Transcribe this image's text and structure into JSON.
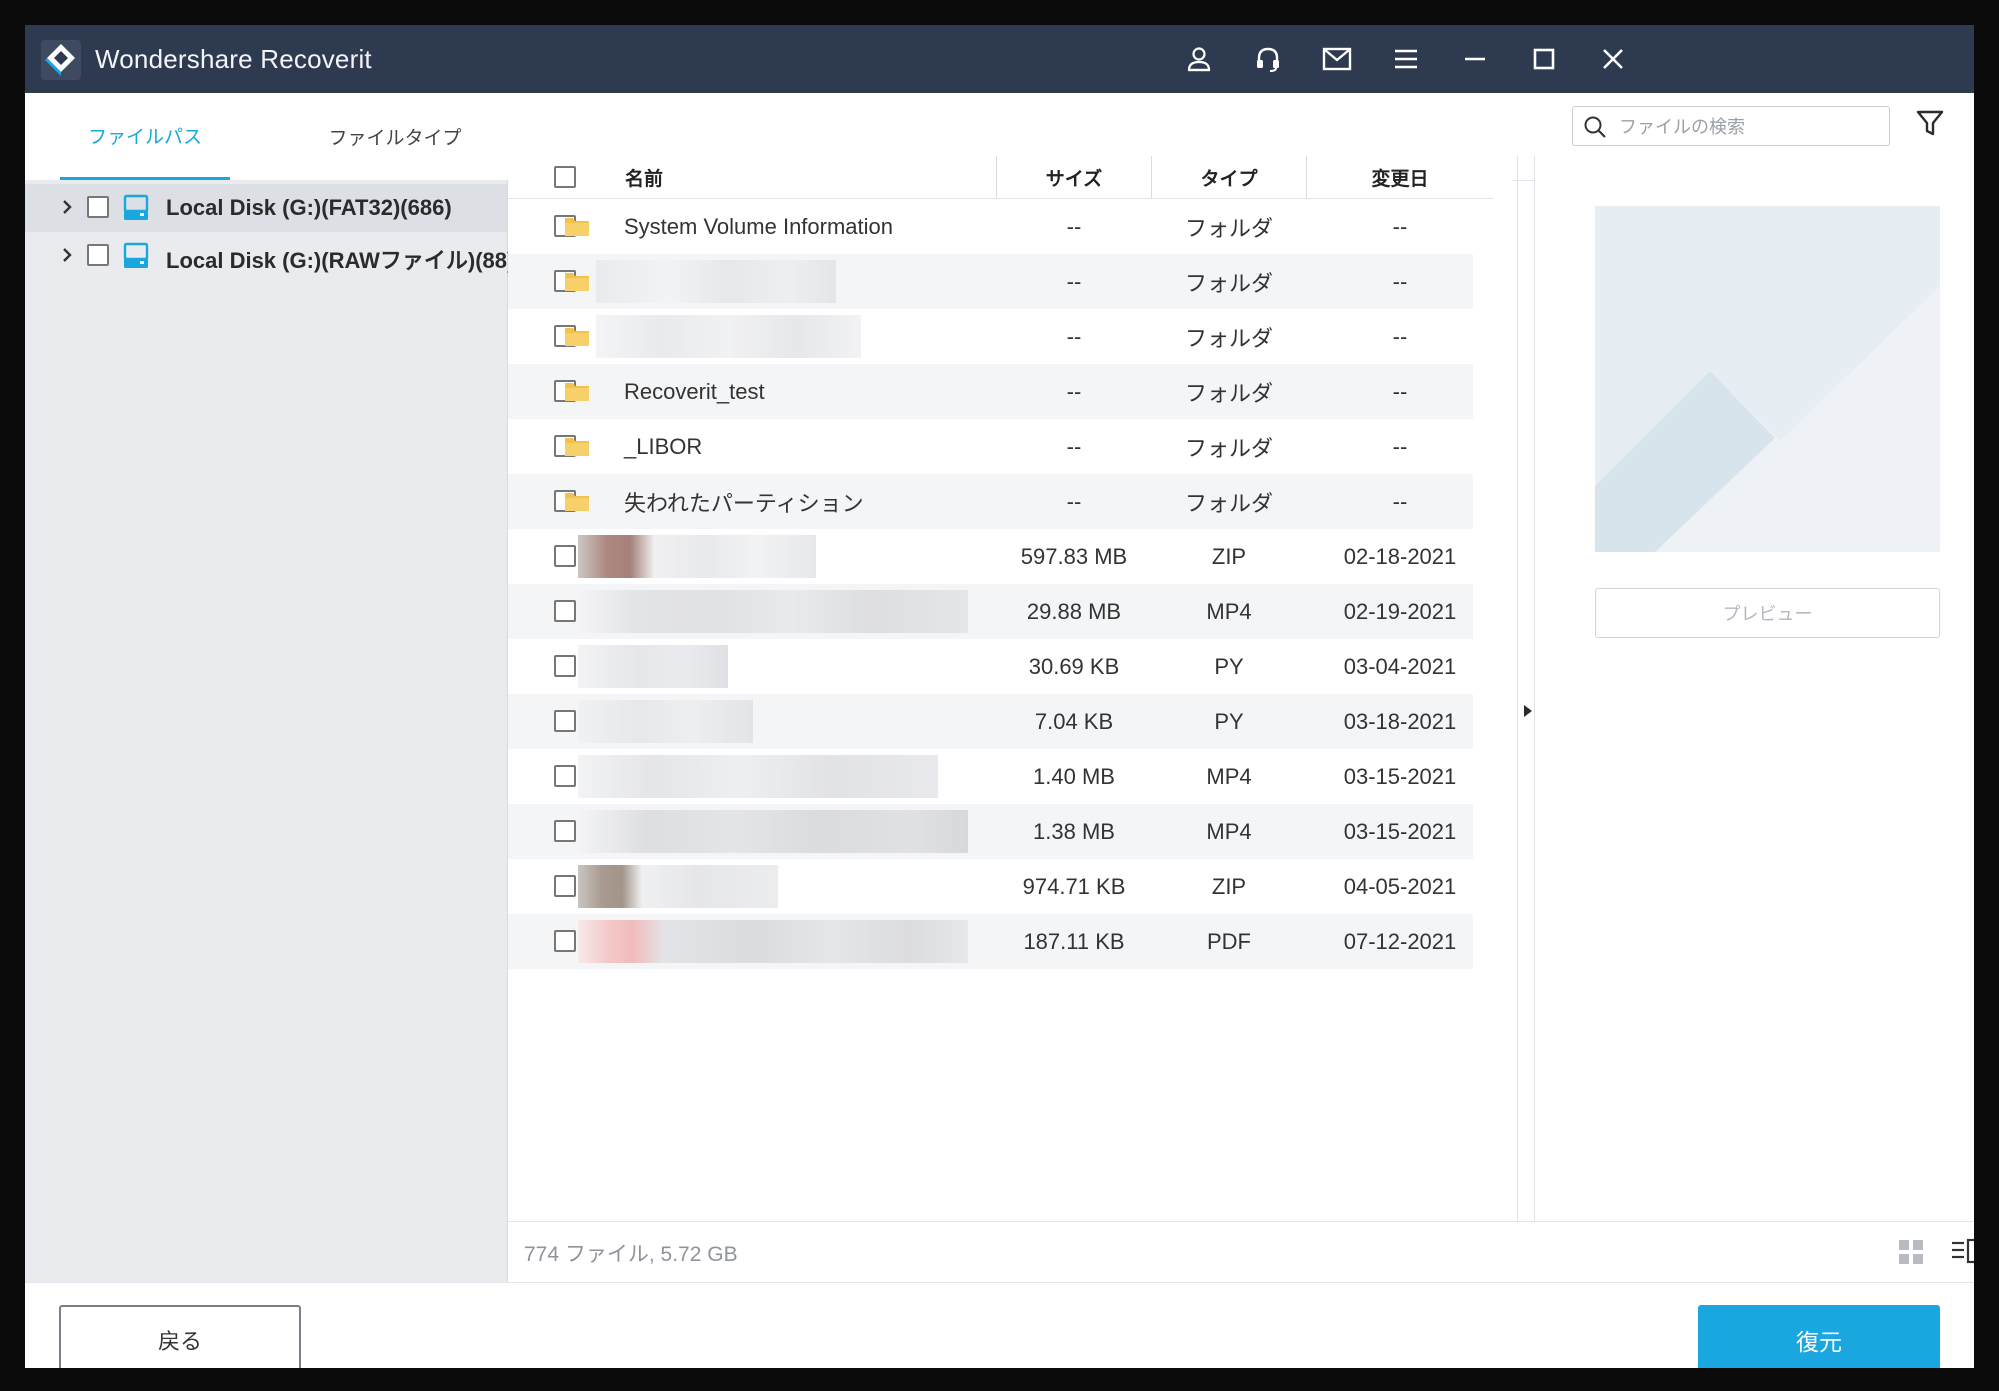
{
  "app": {
    "title": "Wondershare Recoverit"
  },
  "titlebar_icons": [
    "user-icon",
    "headset-icon",
    "mail-icon",
    "menu-icon",
    "minimize-icon",
    "maximize-icon",
    "close-icon"
  ],
  "tabs": {
    "file_path": "ファイルパス",
    "file_type": "ファイルタイプ"
  },
  "tree": [
    {
      "label": "Local Disk (G:)(FAT32)(686)",
      "selected": true
    },
    {
      "label": "Local Disk (G:)(RAWファイル)(88)",
      "selected": false
    }
  ],
  "search": {
    "placeholder": "ファイルの検索"
  },
  "table": {
    "headers": {
      "name": "名前",
      "size": "サイズ",
      "type": "タイプ",
      "modified": "変更日"
    },
    "rows": [
      {
        "name": "System Volume Information",
        "size": "--",
        "type": "フォルダ",
        "date": "--",
        "kind": "folder"
      },
      {
        "name": "",
        "size": "--",
        "type": "フォルダ",
        "date": "--",
        "kind": "folder"
      },
      {
        "name": "",
        "size": "--",
        "type": "フォルダ",
        "date": "--",
        "kind": "folder"
      },
      {
        "name": "Recoverit_test",
        "size": "--",
        "type": "フォルダ",
        "date": "--",
        "kind": "folder"
      },
      {
        "name": "_LIBOR",
        "size": "--",
        "type": "フォルダ",
        "date": "--",
        "kind": "folder"
      },
      {
        "name": "失われたパーティション",
        "size": "--",
        "type": "フォルダ",
        "date": "--",
        "kind": "folder"
      },
      {
        "name": "",
        "size": "597.83 MB",
        "type": "ZIP",
        "date": "02-18-2021",
        "kind": "file"
      },
      {
        "name": "",
        "size": "29.88 MB",
        "type": "MP4",
        "date": "02-19-2021",
        "kind": "file"
      },
      {
        "name": "",
        "size": "30.69 KB",
        "type": "PY",
        "date": "03-04-2021",
        "kind": "file"
      },
      {
        "name": "",
        "size": "7.04 KB",
        "type": "PY",
        "date": "03-18-2021",
        "kind": "file"
      },
      {
        "name": "",
        "size": "1.40 MB",
        "type": "MP4",
        "date": "03-15-2021",
        "kind": "file"
      },
      {
        "name": "",
        "size": "1.38 MB",
        "type": "MP4",
        "date": "03-15-2021",
        "kind": "file"
      },
      {
        "name": "",
        "size": "974.71 KB",
        "type": "ZIP",
        "date": "04-05-2021",
        "kind": "file"
      },
      {
        "name": "",
        "size": "187.11 KB",
        "type": "PDF",
        "date": "07-12-2021",
        "kind": "file"
      }
    ]
  },
  "preview": {
    "button_label": "プレビュー"
  },
  "status": {
    "summary": "774 ファイル, 5.72 GB"
  },
  "footer": {
    "back_label": "戻る",
    "recover_label": "復元"
  },
  "colors": {
    "titlebar": "#2e3a4f",
    "accent": "#1aa6de",
    "sidebar": "#e9ebee"
  }
}
